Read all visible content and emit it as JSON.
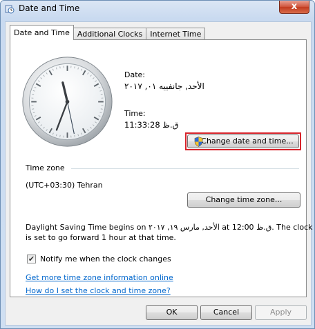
{
  "window": {
    "title": "Date and Time",
    "close_glyph": "x"
  },
  "tabs": [
    {
      "label": "Date and Time"
    },
    {
      "label": "Additional Clocks"
    },
    {
      "label": "Internet Time"
    }
  ],
  "date": {
    "label": "Date:",
    "value": "الأحد, جانفييه ٠١, ٢٠١٧"
  },
  "time": {
    "label": "Time:",
    "value": "ق.ظ 11:33:28"
  },
  "clock": {
    "hour": 11,
    "minute": 33,
    "second": 28
  },
  "buttons": {
    "change_date_time": "Change date and time...",
    "change_time_zone": "Change time zone...",
    "ok": "OK",
    "cancel": "Cancel",
    "apply": "Apply"
  },
  "timezone": {
    "heading": "Time zone",
    "value": "(UTC+03:30) Tehran"
  },
  "dst": {
    "line1": "Daylight Saving Time begins on الأحد, مارس ١٩, ٢٠١٧ at 12:00 ق.ظ. The clock",
    "line2": "is set to go forward 1 hour at that time."
  },
  "notify": {
    "label": "Notify me when the clock changes",
    "checked": true
  },
  "links": {
    "more_info": "Get more time zone information online",
    "how_to": "How do I set the clock and time zone?"
  }
}
